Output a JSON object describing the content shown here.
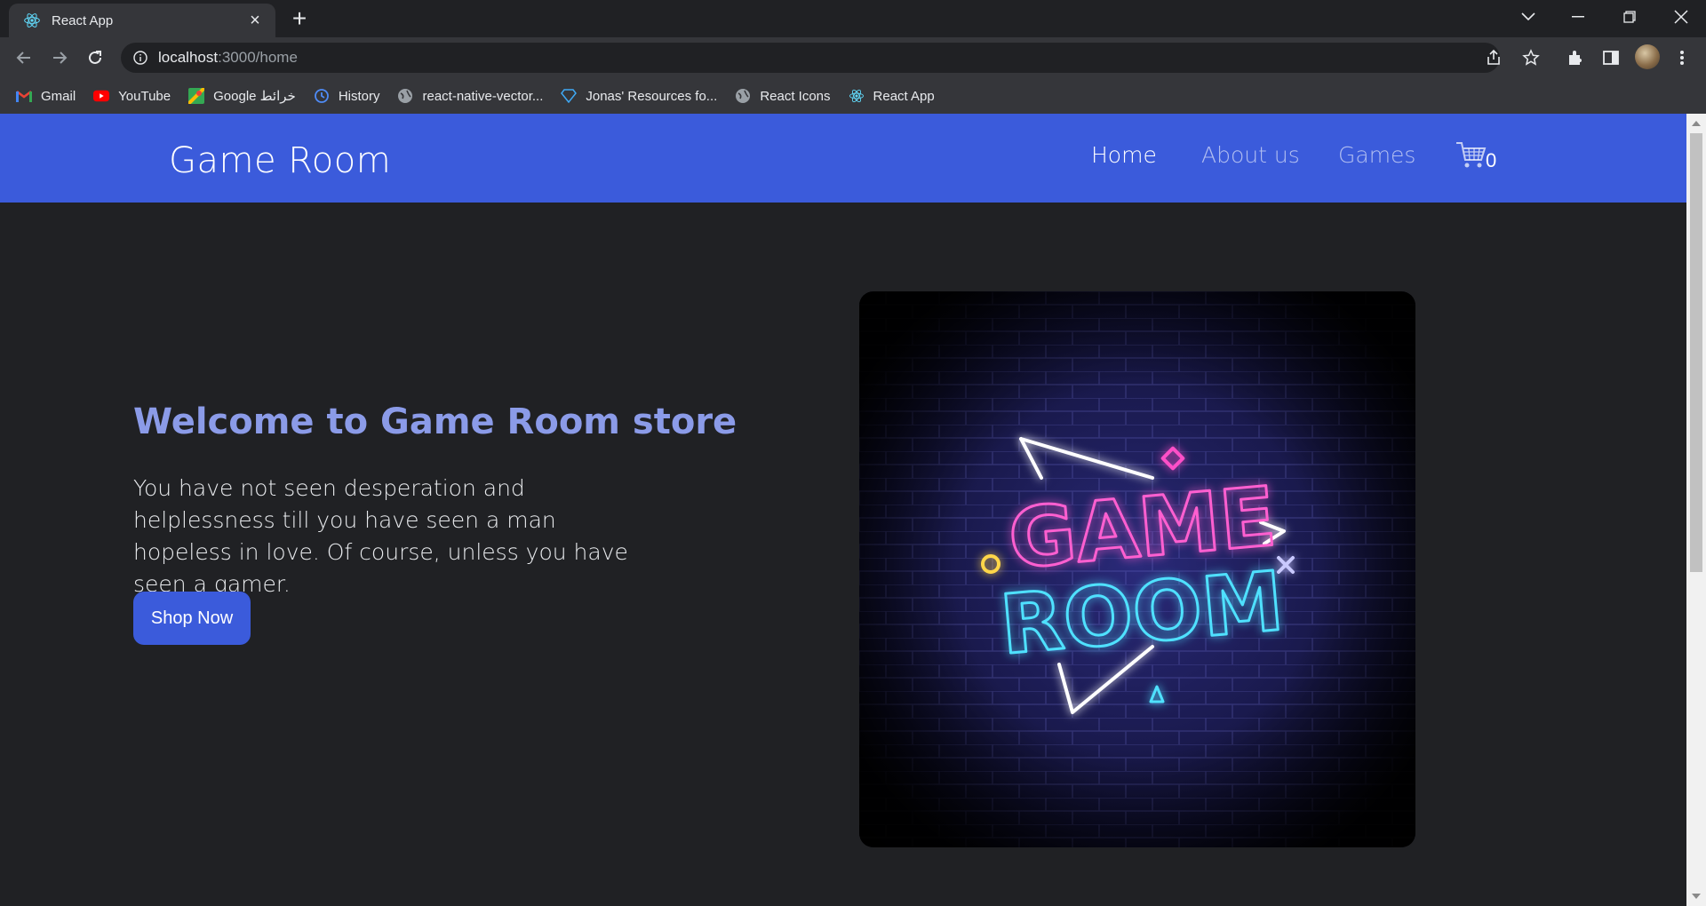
{
  "browser": {
    "tab_title": "React App",
    "url_host": "localhost",
    "url_path": ":3000/home",
    "bookmarks": [
      {
        "label": "Gmail",
        "icon": "gmail-icon"
      },
      {
        "label": "YouTube",
        "icon": "youtube-icon"
      },
      {
        "label": "Google خرائط",
        "icon": "google-maps-icon"
      },
      {
        "label": "History",
        "icon": "history-icon"
      },
      {
        "label": "react-native-vector...",
        "icon": "globe-icon"
      },
      {
        "label": "Jonas' Resources fo...",
        "icon": "diamond-icon"
      },
      {
        "label": "React Icons",
        "icon": "globe-icon"
      },
      {
        "label": "React App",
        "icon": "react-icon"
      }
    ]
  },
  "navbar": {
    "brand": "Game Room",
    "links": [
      {
        "label": "Home",
        "active": true
      },
      {
        "label": "About us",
        "active": false
      },
      {
        "label": "Games",
        "active": false
      }
    ],
    "cart_count": "0"
  },
  "hero": {
    "title": "Welcome to Game Room store",
    "text": "You have not seen desperation and helplessness till you have seen a man hopeless in love. Of course, unless you have seen a gamer.",
    "button_label": "Shop Now",
    "image_line1": "GAME",
    "image_line2": "ROOM"
  },
  "colors": {
    "navbar_bg": "#3b5bdb",
    "page_bg": "#202124",
    "title_color": "#8b9be8",
    "button_bg": "#3b5bdb"
  }
}
